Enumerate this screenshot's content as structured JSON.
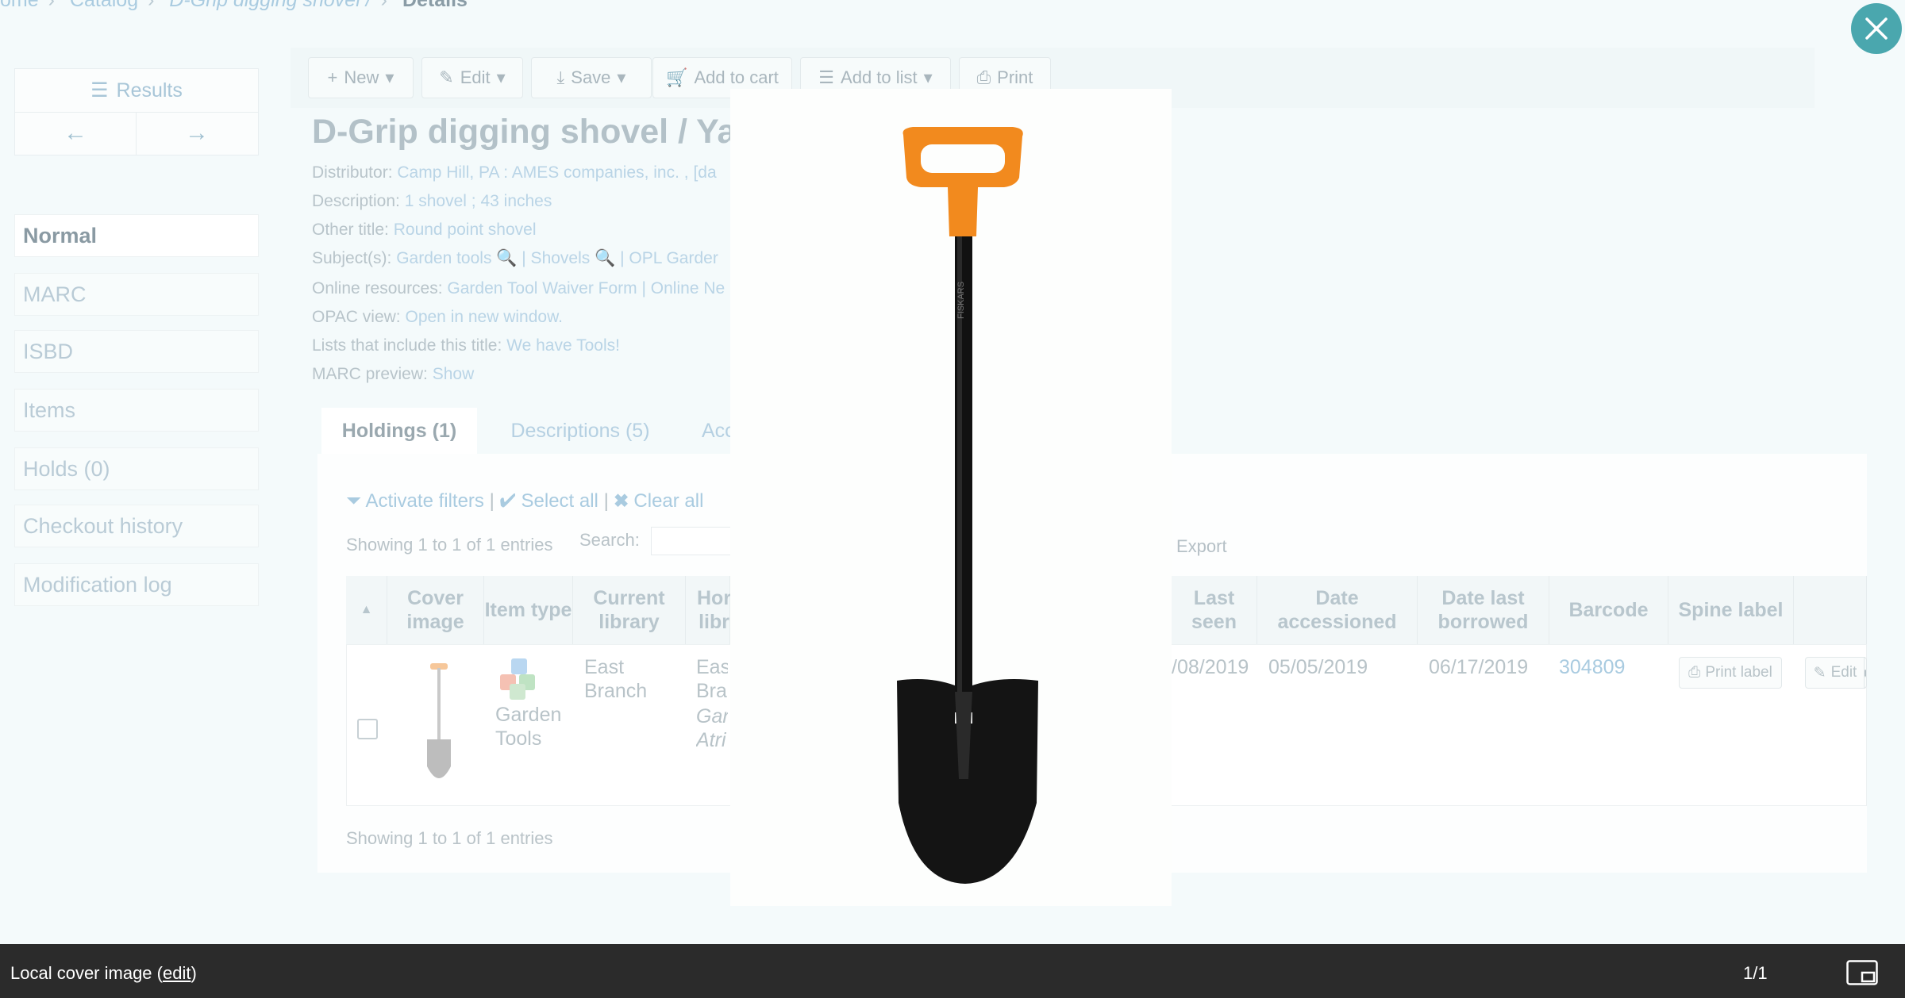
{
  "breadcrumb": {
    "items": [
      "ome",
      "Catalog",
      "D-Grip digging shovel /"
    ],
    "current": "Details"
  },
  "sidebar": {
    "results_label": "Results",
    "items": [
      {
        "label": "Normal",
        "active": true
      },
      {
        "label": "MARC"
      },
      {
        "label": "ISBD"
      },
      {
        "label": "Items"
      },
      {
        "label": "Holds (0)"
      },
      {
        "label": "Checkout history"
      },
      {
        "label": "Modification log"
      }
    ]
  },
  "toolbar": {
    "new_label": "New",
    "edit_label": "Edit",
    "save_label": "Save",
    "add_to_cart_label": "Add to cart",
    "add_to_list_label": "Add to list",
    "print_label": "Print"
  },
  "record": {
    "title": "D-Grip digging shovel / Yar",
    "fields": [
      {
        "label": "Distributor:",
        "value": "Camp Hill, PA : AMES companies, inc. , [da"
      },
      {
        "label": "Description:",
        "value": "1 shovel ; 43 inches"
      },
      {
        "label": "Other title:",
        "value": "Round point shovel"
      },
      {
        "label": "Subject(s):",
        "value": "Garden tools 🔍 | Shovels 🔍 | OPL Garder"
      },
      {
        "label": "Online resources:",
        "value": "Garden Tool Waiver Form | Online Ne"
      },
      {
        "label": "OPAC view:",
        "value": "Open in new window."
      },
      {
        "label": "Lists that include this title:",
        "value": "We have Tools!"
      },
      {
        "label": "MARC preview:",
        "value": "Show"
      }
    ]
  },
  "tabs": [
    {
      "label": "Holdings (1)"
    },
    {
      "label": "Descriptions (5)"
    },
    {
      "label": "Acc"
    }
  ],
  "holdings": {
    "activate_filters": "Activate filters",
    "select_all": "Select all",
    "clear_all": "Clear all",
    "showing_top": "Showing 1 to 1 of 1 entries",
    "showing_bottom": "Showing 1 to 1 of 1 entries",
    "search_label": "Search:",
    "export_label": "Export",
    "headers": [
      "Cover image",
      "Item type",
      "Current library",
      "Hor libr",
      "Last seen",
      "Date accessioned",
      "Date last borrowed",
      "Barcode",
      "Spine label"
    ],
    "row": {
      "item_type": "Garden Tools",
      "current_library": "East Branch",
      "home_library": "Eas Brai",
      "home_library_note": "Gar Atri",
      "last_seen": "/08/2019",
      "date_accessioned": "05/05/2019",
      "date_last_borrowed": "06/17/2019",
      "barcode": "304809",
      "print_label": "Print label",
      "edit_label": "Edit"
    }
  },
  "lightbox": {
    "caption_prefix": "Local cover image (",
    "caption_link": "edit",
    "caption_suffix": ")",
    "counter": "1/1",
    "shovel_brand": "FISKARS"
  },
  "colors": {
    "close_button": "#4aa7ae",
    "handle_orange": "#f28a1e",
    "footer_bg": "#2b2b2b"
  }
}
